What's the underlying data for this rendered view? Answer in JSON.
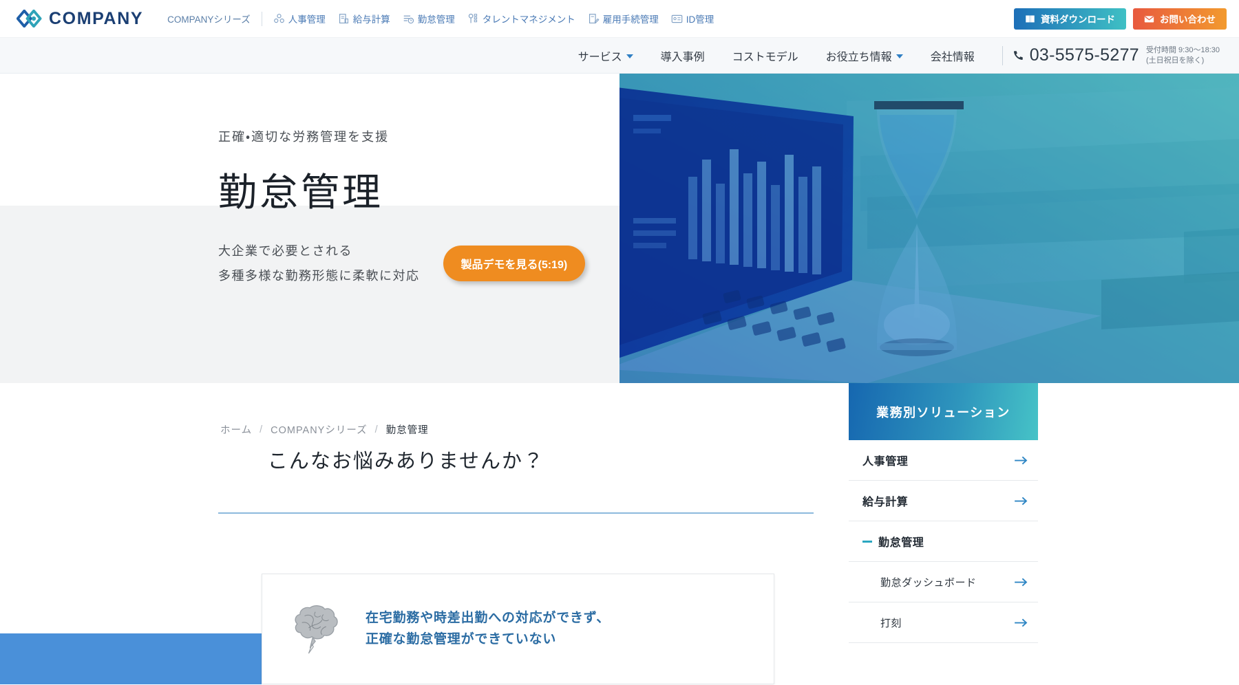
{
  "brand": {
    "name": "COMPANY",
    "logo_icon": "company-diamond-logo"
  },
  "topbar": {
    "nav": [
      {
        "label": "COMPANYシリーズ",
        "icon": "none"
      },
      {
        "label": "人事管理",
        "icon": "people-icon"
      },
      {
        "label": "給与計算",
        "icon": "payroll-document-icon"
      },
      {
        "label": "勤怠管理",
        "icon": "clock-list-icon"
      },
      {
        "label": "タレントマネジメント",
        "icon": "talent-person-icon"
      },
      {
        "label": "雇用手続管理",
        "icon": "document-pen-icon"
      },
      {
        "label": "ID管理",
        "icon": "id-card-icon"
      }
    ],
    "download_button": {
      "label": "資料ダウンロード",
      "icon": "book-icon",
      "color_from": "#1d6fb8",
      "color_to": "#3fc0c4"
    },
    "contact_button": {
      "label": "お問い合わせ",
      "icon": "mail-icon",
      "color_from": "#e8593f",
      "color_to": "#f29a2e"
    }
  },
  "mainnav": {
    "items": [
      {
        "label": "サービス",
        "has_dropdown": true
      },
      {
        "label": "導入事例",
        "has_dropdown": false
      },
      {
        "label": "コストモデル",
        "has_dropdown": false
      },
      {
        "label": "お役立ち情報",
        "has_dropdown": true
      },
      {
        "label": "会社情報",
        "has_dropdown": false
      }
    ],
    "phone": {
      "icon": "phone-icon",
      "number": "03-5575-5277",
      "hours_line1": "受付時間 9:30〜18:30",
      "hours_line2": "(土日祝日を除く)"
    }
  },
  "hero": {
    "kicker": "正確・適切な労務管理を支援",
    "title": "勤怠管理",
    "lead_line1": "大企業で必要とされる",
    "lead_line2": "多種多様な勤務形態に柔軟に対応",
    "demo_button": {
      "label": "製品デモを見る(5:19)",
      "color": "#ef8c20"
    },
    "image_alt": "砂時計とノートパソコン",
    "image_overlay_from": "#1b5fc4",
    "image_overlay_to": "#4ccfd0"
  },
  "breadcrumb": {
    "items": [
      "ホーム",
      "COMPANYシリーズ",
      "勤怠管理"
    ],
    "separator": "/"
  },
  "main": {
    "section_title": "こんなお悩みありませんか？",
    "accent_color": "#8cb9dd",
    "cards": [
      {
        "icon": "thought-cloud-icon",
        "line1": "在宅勤務や時差出勤への対応ができず、",
        "line2": "正確な勤怠管理ができていない",
        "text_color": "#2b6ca3"
      }
    ],
    "band_color": "#4a90d9"
  },
  "sidebar": {
    "header": "業務別ソリューション",
    "header_from": "#1667b0",
    "header_to": "#46c3c7",
    "items": [
      {
        "label": "人事管理",
        "active": false,
        "arrow": "arrow-right-icon"
      },
      {
        "label": "給与計算",
        "active": false,
        "arrow": "arrow-right-icon"
      },
      {
        "label": "勤怠管理",
        "active": true,
        "arrow": "minus-icon"
      }
    ],
    "subitems": [
      {
        "label": "勤怠ダッシュボード",
        "arrow": "arrow-right-icon"
      },
      {
        "label": "打刻",
        "arrow": "arrow-right-icon"
      }
    ]
  }
}
